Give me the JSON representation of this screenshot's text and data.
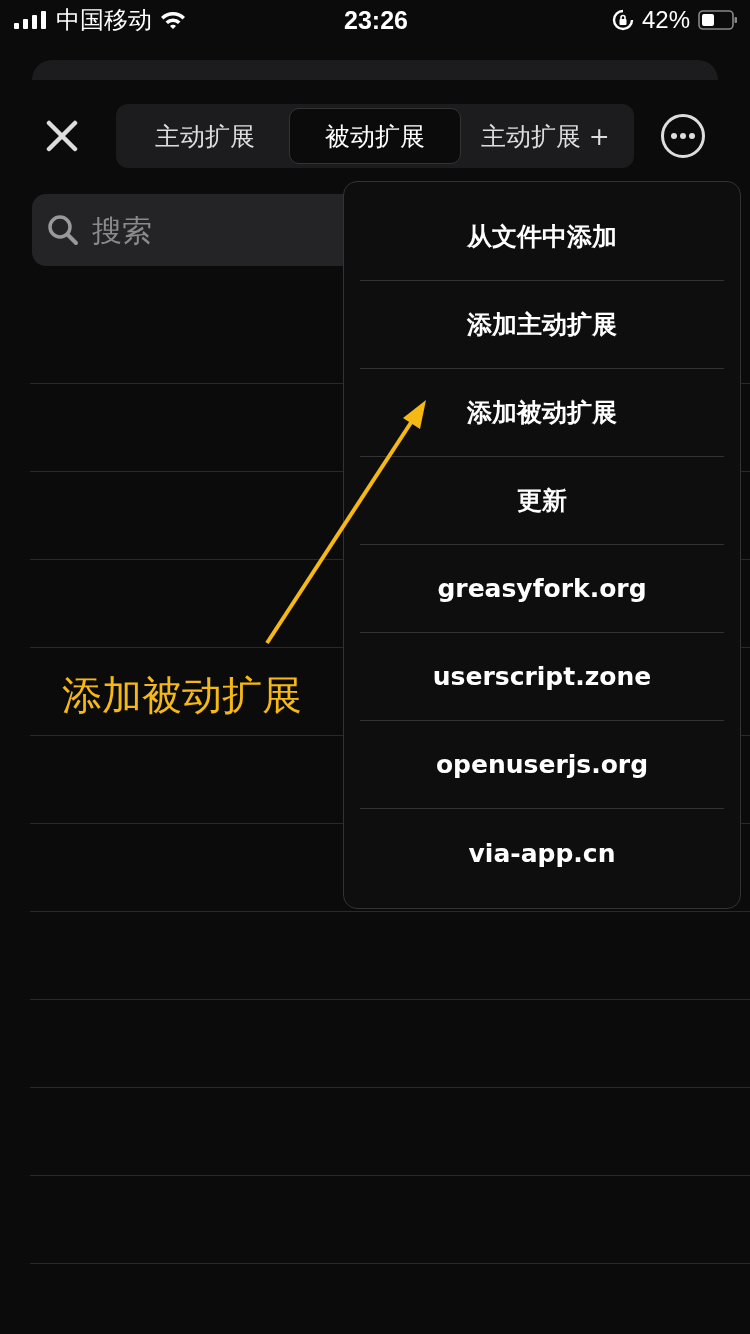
{
  "status_bar": {
    "carrier": "中国移动",
    "time": "23:26",
    "battery": "42%"
  },
  "tabs": [
    {
      "label": "主动扩展",
      "selected": false
    },
    {
      "label": "被动扩展",
      "selected": true
    },
    {
      "label": "主动扩展 +",
      "selected": false
    }
  ],
  "search": {
    "placeholder": "搜索"
  },
  "menu": {
    "items": [
      "从文件中添加",
      "添加主动扩展",
      "添加被动扩展",
      "更新",
      "greasyfork.org",
      "userscript.zone",
      "openuserjs.org",
      "via-app.cn"
    ]
  },
  "annotation": {
    "text": "添加被动扩展"
  }
}
